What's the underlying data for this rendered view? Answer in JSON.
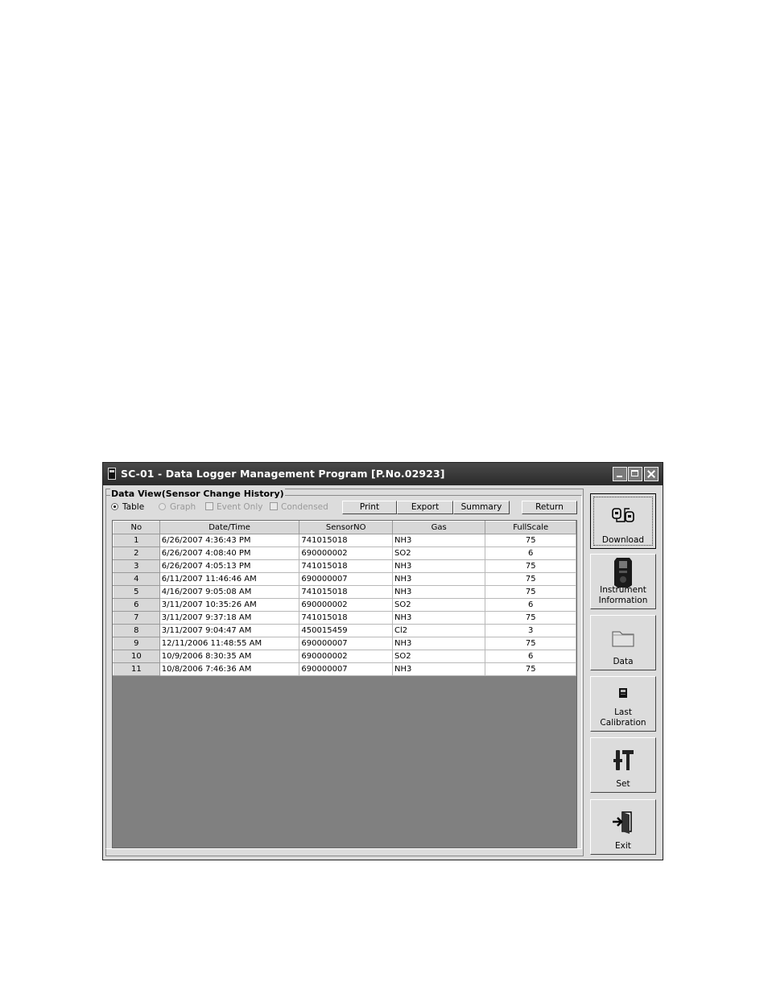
{
  "window": {
    "title": "SC-01 - Data Logger Management Program [P.No.02923]",
    "controls": {
      "minimize": "minimize",
      "maximize": "maximize",
      "close": "close"
    }
  },
  "data_view": {
    "group_label": "Data View(Sensor Change History)",
    "options": {
      "table": {
        "label": "Table",
        "selected": true
      },
      "graph": {
        "label": "Graph",
        "enabled": false
      },
      "event_only": {
        "label": "Event Only",
        "enabled": false
      },
      "condensed": {
        "label": "Condensed",
        "enabled": false
      }
    },
    "buttons": {
      "print": "Print",
      "export": "Export",
      "summary": "Summary",
      "return": "Return"
    }
  },
  "table": {
    "columns": [
      "No",
      "Date/Time",
      "SensorNO",
      "Gas",
      "FullScale"
    ],
    "rows": [
      [
        "1",
        "6/26/2007 4:36:43 PM",
        "741015018",
        "NH3",
        "75"
      ],
      [
        "2",
        "6/26/2007 4:08:40 PM",
        "690000002",
        "SO2",
        "6"
      ],
      [
        "3",
        "6/26/2007 4:05:13 PM",
        "741015018",
        "NH3",
        "75"
      ],
      [
        "4",
        "6/11/2007 11:46:46 AM",
        "690000007",
        "NH3",
        "75"
      ],
      [
        "5",
        "4/16/2007 9:05:08 AM",
        "741015018",
        "NH3",
        "75"
      ],
      [
        "6",
        "3/11/2007 10:35:26 AM",
        "690000002",
        "SO2",
        "6"
      ],
      [
        "7",
        "3/11/2007 9:37:18 AM",
        "741015018",
        "NH3",
        "75"
      ],
      [
        "8",
        "3/11/2007 9:04:47 AM",
        "450015459",
        "Cl2",
        "3"
      ],
      [
        "9",
        "12/11/2006 11:48:55 AM",
        "690000007",
        "NH3",
        "75"
      ],
      [
        "10",
        "10/9/2006 8:30:35 AM",
        "690000002",
        "SO2",
        "6"
      ],
      [
        "11",
        "10/8/2006 7:46:36 AM",
        "690000007",
        "NH3",
        "75"
      ]
    ]
  },
  "sidebar": {
    "download": "Download",
    "instrument_1": "Instrument",
    "instrument_2": "Information",
    "data": "Data",
    "last_1": "Last",
    "last_2": "Calibration",
    "set": "Set",
    "exit": "Exit"
  }
}
